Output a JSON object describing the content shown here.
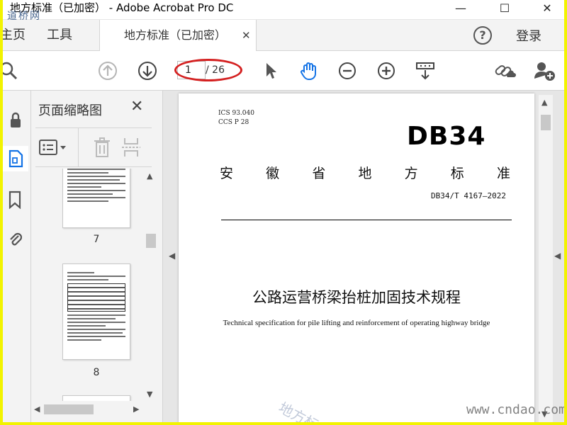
{
  "window": {
    "title": "地方标准（已加密） - Adobe Acrobat Pro DC",
    "minimize": "—",
    "maximize": "☐",
    "close": "✕"
  },
  "watermark": {
    "top": "道桥网",
    "diagonal": "地方标",
    "bottom": "www.cndao.com"
  },
  "tabs": {
    "home": "主页",
    "tools": "工具",
    "document": "地方标准（已加密）",
    "document_close": "✕",
    "help": "?",
    "login": "登录"
  },
  "toolbar": {
    "page_current": "1",
    "page_total": "/ 26"
  },
  "thumbnails": {
    "title": "页面缩略图",
    "close": "✕",
    "pages": [
      {
        "label": "7"
      },
      {
        "label": "8"
      }
    ]
  },
  "document": {
    "ics": "ICS  93.040",
    "ccs": "CCS  P  28",
    "logo": "DB34",
    "province_chars": [
      "安",
      "徽",
      "省",
      "地",
      "方",
      "标",
      "准"
    ],
    "standard_no": "DB34/T 4167—2022",
    "title_cn": "公路运营桥梁抬桩加固技术规程",
    "title_en": "Technical specification for pile lifting and reinforcement of operating highway bridge"
  },
  "colors": {
    "frame": "#f2f300",
    "accent": "#1473e6",
    "annotation": "#d42020"
  }
}
